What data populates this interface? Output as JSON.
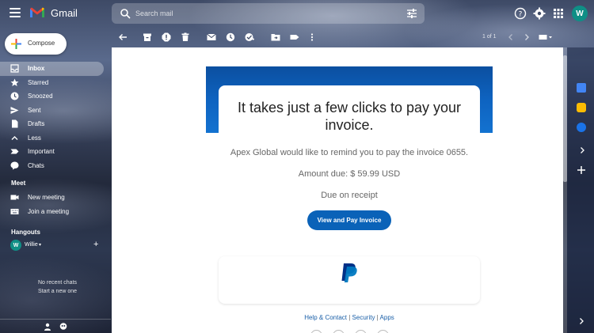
{
  "app": {
    "brand": "Gmail",
    "avatar_initial": "W"
  },
  "search": {
    "placeholder": "Search mail"
  },
  "compose": {
    "label": "Compose"
  },
  "nav": [
    {
      "label": "Inbox",
      "icon": "inbox-icon",
      "active": true
    },
    {
      "label": "Starred",
      "icon": "star-icon"
    },
    {
      "label": "Snoozed",
      "icon": "clock-icon"
    },
    {
      "label": "Sent",
      "icon": "send-icon"
    },
    {
      "label": "Drafts",
      "icon": "draft-icon"
    },
    {
      "label": "Less",
      "icon": "chevron-up-icon"
    },
    {
      "label": "Important",
      "icon": "important-icon"
    },
    {
      "label": "Chats",
      "icon": "chat-icon"
    }
  ],
  "meet": {
    "title": "Meet",
    "items": [
      {
        "label": "New meeting",
        "icon": "video-icon"
      },
      {
        "label": "Join a meeting",
        "icon": "keyboard-icon"
      }
    ]
  },
  "hangouts": {
    "title": "Hangouts",
    "user": "Willie",
    "user_initial": "W",
    "no_chats": "No recent chats",
    "start_new": "Start a new one"
  },
  "toolbar": {
    "paging": "1 of 1"
  },
  "email": {
    "headline": "It takes just a few clicks to pay your invoice.",
    "reminder": "Apex Global would like to remind you to pay the invoice 0655.",
    "amount": "Amount due: $ 59.99 USD",
    "due": "Due on receipt",
    "button": "View and Pay Invoice",
    "footer": {
      "help": "Help & Contact",
      "security": "Security",
      "apps": "Apps",
      "separator": " | "
    }
  },
  "colors": {
    "accent": "#0a62b8",
    "avatar": "#0f8f86",
    "banner": "#0e63c0"
  }
}
